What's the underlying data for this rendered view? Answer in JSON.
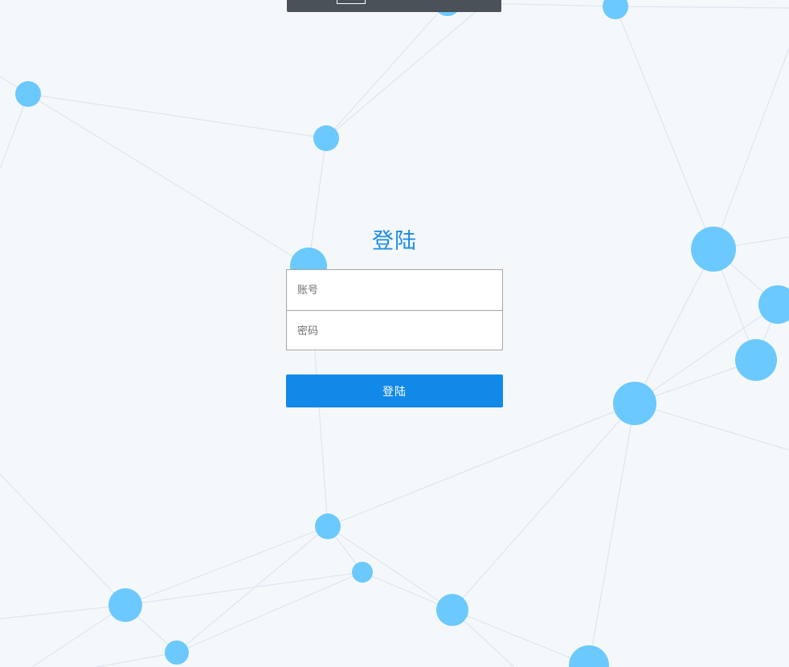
{
  "login": {
    "title": "登陆",
    "account_placeholder": "账号",
    "password_placeholder": "密码",
    "submit_label": "登陆"
  },
  "colors": {
    "background": "#f5f8fb",
    "node": "#5ec4fd",
    "link": "#dde6ee",
    "accent": "#1189e9",
    "title": "#1b8ce4",
    "topbar": "#4a5159"
  }
}
